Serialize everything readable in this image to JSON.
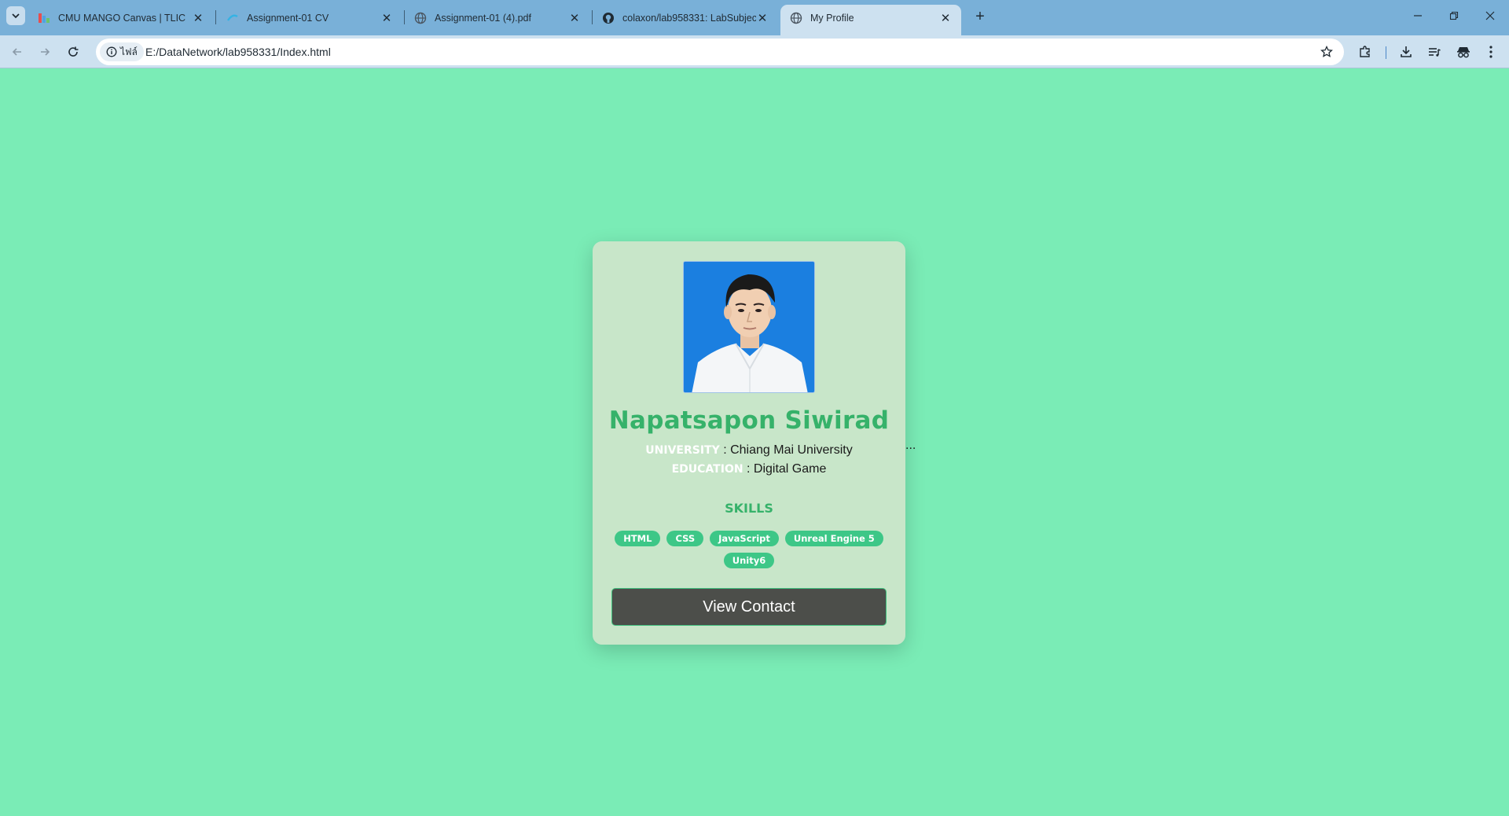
{
  "browser": {
    "tabs": [
      {
        "title": "CMU MANGO Canvas | TLIC",
        "favicon": "canvas-icon"
      },
      {
        "title": "Assignment-01 CV",
        "favicon": "figma-icon"
      },
      {
        "title": "Assignment-01 (4).pdf",
        "favicon": "globe-icon"
      },
      {
        "title": "colaxon/lab958331: LabSubject",
        "favicon": "github-icon"
      },
      {
        "title": "My Profile",
        "favicon": "globe-icon",
        "active": true
      }
    ],
    "site_chip": "ไฟล์",
    "url": "E:/DataNetwork/lab958331/Index.html"
  },
  "profile": {
    "name": "Napatsapon Siwirad",
    "university_label": "UNIVERSITY",
    "university_value": " : Chiang Mai University",
    "education_label": "EDUCATION",
    "education_value": " : Digital Game",
    "skills_title": "SKILLS",
    "skills": [
      "HTML",
      "CSS",
      "JavaScript",
      "Unreal Engine 5",
      "Unity6"
    ],
    "contact_button": "View Contact",
    "ellipsis": "..."
  },
  "colors": {
    "page_background": "#7aecb6",
    "card_background": "#c8e6c9",
    "accent_green": "#36b26a",
    "badge_green": "#3dc787",
    "button_dark": "#4c4e4a"
  }
}
